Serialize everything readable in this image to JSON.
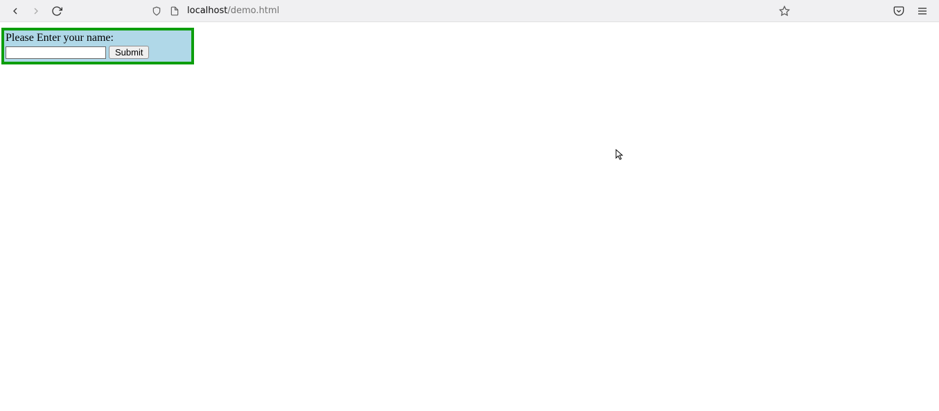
{
  "browser": {
    "url": {
      "host": "localhost",
      "path": "/demo.html"
    }
  },
  "form": {
    "label": "Please Enter your name:",
    "input_value": "",
    "submit_label": "Submit"
  }
}
